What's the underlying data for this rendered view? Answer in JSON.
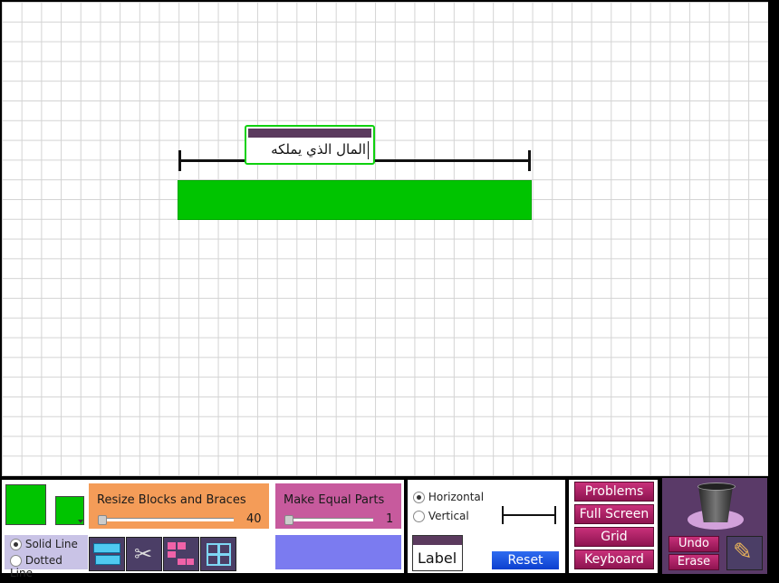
{
  "workspace": {
    "label_text": "المال الذي يملكه",
    "block_color": "#00c400"
  },
  "toolbar": {
    "color_current": "#00c400",
    "line_style": {
      "options": [
        "Solid Line",
        "Dotted Line"
      ],
      "selected": "Solid Line"
    },
    "resize": {
      "title": "Resize Blocks and Braces",
      "value": "40"
    },
    "equal_parts": {
      "title": "Make Equal Parts",
      "value": "1"
    },
    "tools": [
      "split-tool-icon",
      "scissors-icon",
      "join-tool-icon",
      "grid-tool-icon"
    ],
    "orientation": {
      "options": [
        "Horizontal",
        "Vertical"
      ],
      "selected": "Horizontal"
    },
    "label_button": "Label",
    "reset_button": "Reset",
    "menu": [
      "Problems",
      "Full Screen",
      "Grid",
      "Keyboard"
    ],
    "undo_button": "Undo",
    "erase_button": "Erase"
  }
}
